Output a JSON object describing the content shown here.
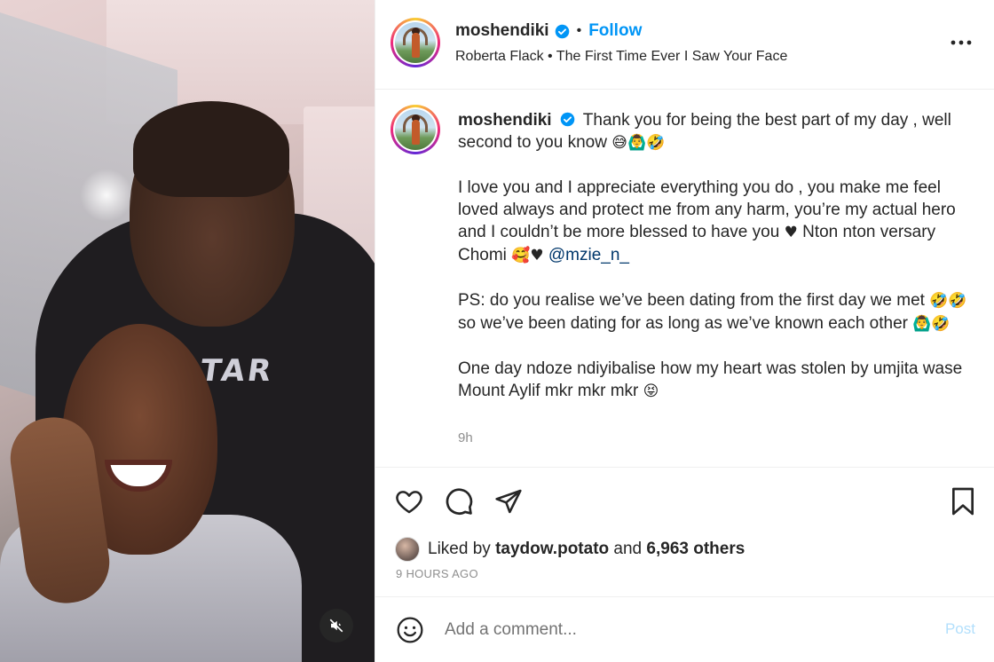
{
  "header": {
    "username": "moshendiki",
    "follow_label": "Follow",
    "separator": "•",
    "audio": "Roberta Flack • The First Time Ever I Saw Your Face"
  },
  "caption": {
    "username": "moshendiki",
    "p1": "Thank you for being the best part of my day , well second to you know",
    "p1_emojis": "😅🙆‍♂️🤣",
    "p2": "I love you and I appreciate everything you do , you make me feel loved always and protect me from any harm, you’re my actual hero and I couldn’t be more blessed to have you",
    "p2_heart": "♥",
    "p2_cont": "Nton nton versary Chomi",
    "p2_emojis": "🥰♥",
    "mention": "@mzie_n_",
    "p3_a": "PS: do you realise we’ve been dating from the first day we met",
    "p3_emojis_a": "🤣🤣",
    "p3_b": "so we’ve been dating for as long as we’ve known each other",
    "p3_emojis_b": "🙆‍♂️🤣",
    "p4": "One day ndoze ndiyibalise how my heart was stolen by umjita wase Mount Aylif mkr mkr mkr",
    "p4_emoji": "😝",
    "time": "9h"
  },
  "media": {
    "hoodie_text": "TAR"
  },
  "likes": {
    "prefix": "Liked by",
    "user": "taydow.potato",
    "and": "and",
    "others": "6,963 others"
  },
  "posted_ago": "9 HOURS AGO",
  "comment": {
    "placeholder": "Add a comment...",
    "post_label": "Post"
  },
  "icons": {
    "verified": "verified-badge-icon",
    "more": "more-options-icon",
    "like": "heart-icon",
    "comment": "comment-icon",
    "share": "share-icon",
    "save": "bookmark-icon",
    "emoji": "emoji-icon",
    "mute": "muted-audio-icon"
  },
  "colors": {
    "accent": "#0095f6",
    "verified": "#0095f6",
    "muted_text": "#8e8e8e",
    "post_disabled": "#b2dffc"
  }
}
